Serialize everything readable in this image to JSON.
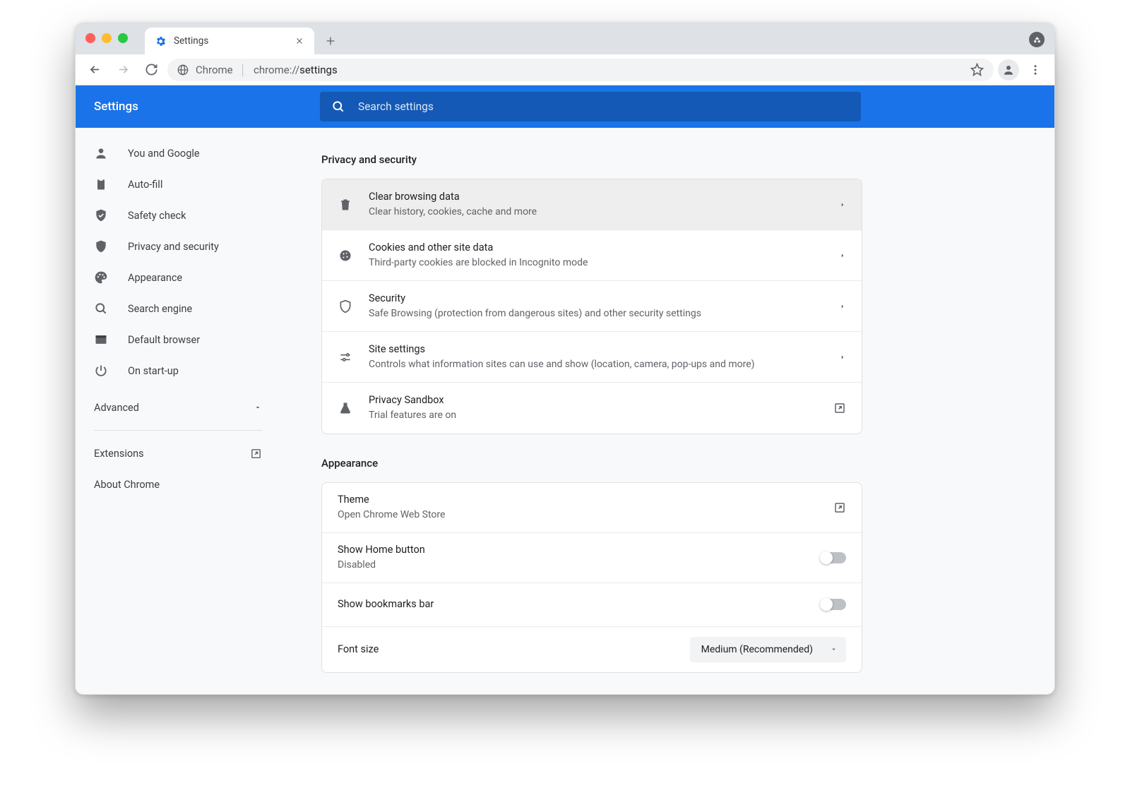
{
  "tab": {
    "title": "Settings"
  },
  "omnibox": {
    "chrome_label": "Chrome",
    "protocol": "chrome://",
    "path": "settings"
  },
  "header": {
    "title": "Settings",
    "search_placeholder": "Search settings"
  },
  "sidebar": {
    "items": [
      {
        "label": "You and Google"
      },
      {
        "label": "Auto-fill"
      },
      {
        "label": "Safety check"
      },
      {
        "label": "Privacy and security"
      },
      {
        "label": "Appearance"
      },
      {
        "label": "Search engine"
      },
      {
        "label": "Default browser"
      },
      {
        "label": "On start-up"
      }
    ],
    "advanced": "Advanced",
    "extensions": "Extensions",
    "about": "About Chrome"
  },
  "sections": {
    "privacy": {
      "title": "Privacy and security",
      "rows": [
        {
          "title": "Clear browsing data",
          "subtitle": "Clear history, cookies, cache and more"
        },
        {
          "title": "Cookies and other site data",
          "subtitle": "Third-party cookies are blocked in Incognito mode"
        },
        {
          "title": "Security",
          "subtitle": "Safe Browsing (protection from dangerous sites) and other security settings"
        },
        {
          "title": "Site settings",
          "subtitle": "Controls what information sites can use and show (location, camera, pop-ups and more)"
        },
        {
          "title": "Privacy Sandbox",
          "subtitle": "Trial features are on"
        }
      ]
    },
    "appearance": {
      "title": "Appearance",
      "theme": {
        "title": "Theme",
        "subtitle": "Open Chrome Web Store"
      },
      "home": {
        "title": "Show Home button",
        "subtitle": "Disabled"
      },
      "bookmarks": {
        "title": "Show bookmarks bar"
      },
      "fontsize": {
        "title": "Font size",
        "value": "Medium (Recommended)"
      }
    }
  }
}
